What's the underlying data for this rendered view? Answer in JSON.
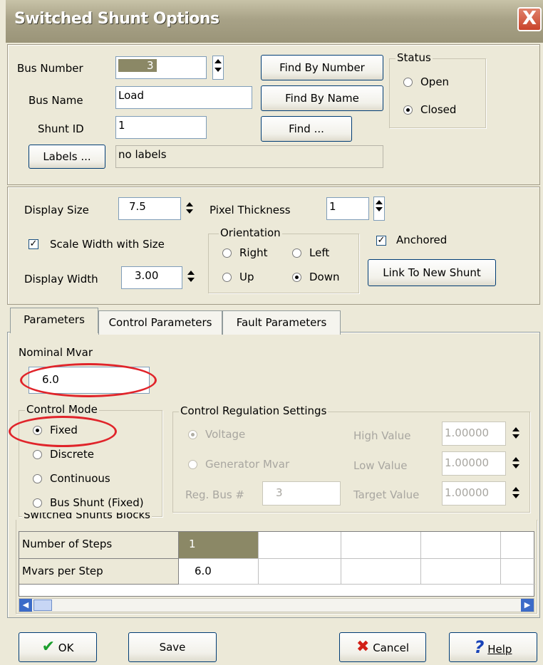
{
  "window": {
    "title": "Switched Shunt Options",
    "close_label": "X"
  },
  "top": {
    "bus_number_label": "Bus Number",
    "bus_number_value": "3",
    "bus_name_label": "Bus Name",
    "bus_name_value": "Load",
    "shunt_id_label": "Shunt ID",
    "shunt_id_value": "1",
    "labels_button": "Labels ...",
    "labels_value": "no labels",
    "find_by_number": "Find By Number",
    "find_by_name": "Find By Name",
    "find": "Find ...",
    "status_title": "Status",
    "status_open": "Open",
    "status_closed": "Closed",
    "status_selected": "Closed"
  },
  "display": {
    "display_size_label": "Display Size",
    "display_size_value": "7.5",
    "pixel_thickness_label": "Pixel Thickness",
    "pixel_thickness_value": "1",
    "scale_width_label": "Scale Width with Size",
    "scale_width_checked": true,
    "display_width_label": "Display Width",
    "display_width_value": "3.00",
    "orientation_title": "Orientation",
    "orientation_right": "Right",
    "orientation_left": "Left",
    "orientation_up": "Up",
    "orientation_down": "Down",
    "orientation_selected": "Down",
    "anchored_label": "Anchored",
    "anchored_checked": true,
    "link_button": "Link To New Shunt"
  },
  "tabs": [
    "Parameters",
    "Control Parameters",
    "Fault Parameters"
  ],
  "active_tab": "Parameters",
  "parameters": {
    "nominal_mvar_label": "Nominal Mvar",
    "nominal_mvar_value": "6.0",
    "control_mode_title": "Control Mode",
    "mode_fixed": "Fixed",
    "mode_discrete": "Discrete",
    "mode_continuous": "Continuous",
    "mode_bus_shunt": "Bus Shunt (Fixed)",
    "mode_selected": "Fixed",
    "regulation_title": "Control Regulation Settings",
    "reg_voltage": "Voltage",
    "reg_gen_mvar": "Generator Mvar",
    "reg_bus_label": "Reg. Bus #",
    "reg_bus_value": "3",
    "high_value_label": "High Value",
    "high_value": "1.00000",
    "low_value_label": "Low Value",
    "low_value": "1.00000",
    "target_value_label": "Target Value",
    "target_value": "1.00000",
    "blocks_title": "Switched Shunts Blocks",
    "rows": [
      {
        "label": "Number of Steps",
        "value": "1"
      },
      {
        "label": "Mvars per Step",
        "value": "6.0"
      }
    ]
  },
  "footer": {
    "ok": "OK",
    "save": "Save",
    "cancel": "Cancel",
    "help": "Help"
  },
  "colors": {
    "annotation_red": "#e0242a",
    "selected_cell": "#8b8866",
    "titlebar": "#a8a287"
  }
}
